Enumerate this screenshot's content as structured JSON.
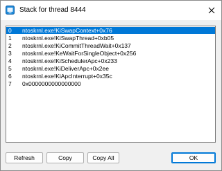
{
  "window": {
    "title": "Stack for thread 8444"
  },
  "icons": {
    "app": "window-app-icon",
    "close": "close-icon"
  },
  "colors": {
    "selection": "#0078d7",
    "list_background": "#ffffff",
    "dialog_background": "#f0f0f0"
  },
  "stack": {
    "selected_index": 0,
    "frames": [
      {
        "index": "0",
        "frame": "ntoskrnl.exe!KiSwapContext+0x76"
      },
      {
        "index": "1",
        "frame": "ntoskrnl.exe!KiSwapThread+0xb05"
      },
      {
        "index": "2",
        "frame": "ntoskrnl.exe!KiCommitThreadWait+0x137"
      },
      {
        "index": "3",
        "frame": "ntoskrnl.exe!KeWaitForSingleObject+0x256"
      },
      {
        "index": "4",
        "frame": "ntoskrnl.exe!KiSchedulerApc+0x233"
      },
      {
        "index": "5",
        "frame": "ntoskrnl.exe!KiDeliverApc+0x2ee"
      },
      {
        "index": "6",
        "frame": "ntoskrnl.exe!KiApcInterrupt+0x35c"
      },
      {
        "index": "7",
        "frame": "0x0000000000000000"
      }
    ]
  },
  "buttons": {
    "refresh": "Refresh",
    "copy": "Copy",
    "copy_all": "Copy All",
    "ok": "OK"
  }
}
